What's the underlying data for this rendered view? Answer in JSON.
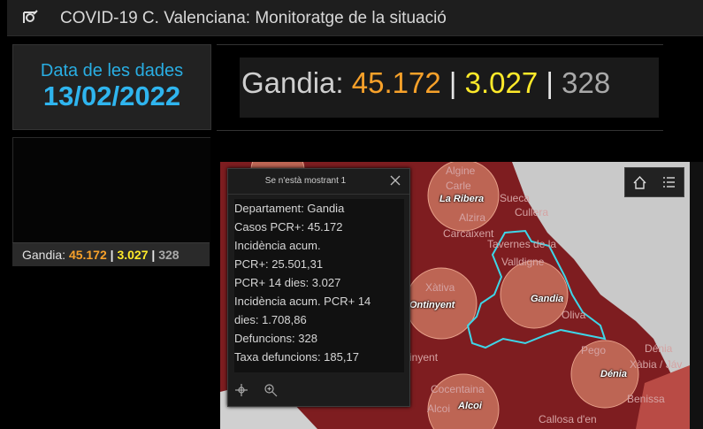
{
  "header": {
    "title": "COVID-19 C. Valenciana: Monitoratge de la situació",
    "logo_icon": "virus-logo-icon"
  },
  "date_card": {
    "label": "Data de les dades",
    "value": "13/02/2022"
  },
  "summary": {
    "name": "Gandia:",
    "cases": "45.172",
    "cases14": "3.027",
    "deaths": "328",
    "sep": "|"
  },
  "summary_small": {
    "name": "Gandia:",
    "cases": "45.172",
    "cases14": "3.027",
    "deaths": "328",
    "sep": "|"
  },
  "popup": {
    "header": "Se n'està mostrant 1",
    "lines": [
      "Departament: Gandia",
      "Casos PCR+: 45.172",
      "Incidència acum.",
      "PCR+: 25.501,31",
      "PCR+ 14 dies: 3.027",
      "Incidència acum. PCR+ 14",
      "dies: 1.708,86",
      "Defuncions: 328",
      "Taxa defuncions: 185,17"
    ]
  },
  "map": {
    "dept_labels": [
      "La Ribera",
      "Ontinyent",
      "Gandia",
      "Dénia",
      "Alcoi"
    ],
    "place_labels": [
      "Algine",
      "Carle",
      "Alzira",
      "Sueca",
      "Cullera",
      "Carcaixent",
      "Tavernes de la",
      "Valldigne",
      "Xàtiva",
      "Oliva",
      "Pego",
      "Dénia",
      "Xàbia / Jáv",
      "Benissa",
      "Cocentaina",
      "Alcoi",
      "Callosa d'en",
      "inyent"
    ]
  },
  "colors": {
    "accent": "#2fb5ef",
    "cases": "#f7a12a",
    "cases14": "#ffea2a",
    "map_fill": "#7e1d20",
    "highlight": "#3ed6e8"
  }
}
